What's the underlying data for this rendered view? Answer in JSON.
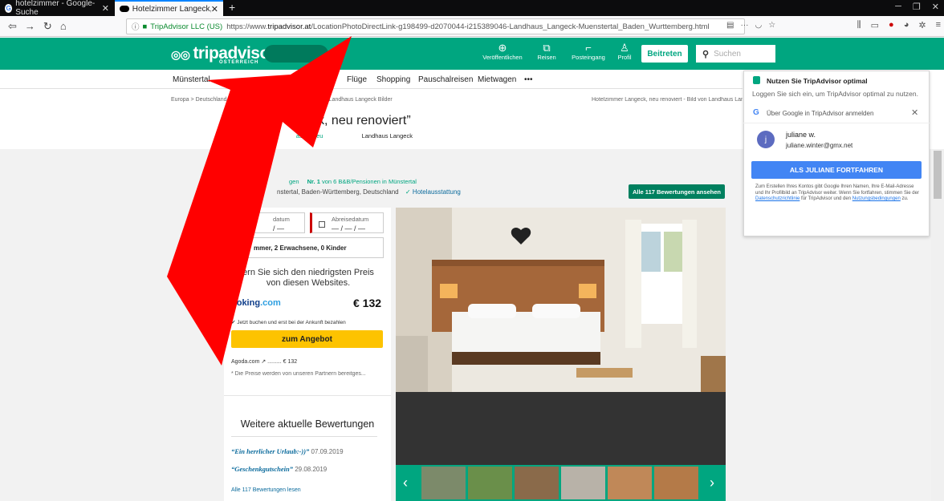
{
  "browser": {
    "tabs": [
      {
        "title": "hotelzimmer - Google-Suche"
      },
      {
        "title": "Hotelzimmer Langeck, neu ren"
      }
    ],
    "url_site": "TripAdvisor LLC (US)",
    "url_prefix": "https://www.",
    "url_host": "tripadvisor.at",
    "url_path": "/LocationPhotoDirectLink-g198499-d2070044-i215389046-Landhaus_Langeck-Muenstertal_Baden_Wurttemberg.html",
    "url_overflow": "···"
  },
  "header": {
    "logo": "tripadvisor",
    "logo_region": "ÖSTERREICH",
    "nav": [
      {
        "label": "Veröffentlichen",
        "icon": "plus-circle-icon",
        "glyph": "⊕"
      },
      {
        "label": "Reisen",
        "icon": "suitcase-icon",
        "glyph": "⧉"
      },
      {
        "label": "Posteingang",
        "icon": "chat-icon",
        "glyph": "⌐"
      },
      {
        "label": "Profil",
        "icon": "user-icon",
        "glyph": "♙"
      }
    ],
    "join_label": "Beitreten",
    "search_placeholder": "Suchen"
  },
  "subnav": {
    "items": [
      "Münstertal",
      "ts",
      "Flüge",
      "Shopping",
      "Pauschalreisen",
      "Mietwagen",
      "•••"
    ]
  },
  "breadcrumbs": {
    "left": [
      "Europa",
      "Deutschland",
      "Bad"
    ],
    "mid": "rtal B&B",
    "last": "Landhaus Langeck Bilder",
    "right": "Hotelzimmer Langeck, neu renoviert - Bild von Landhaus Langec"
  },
  "page": {
    "title": "Fo                 geck, neu renoviert”",
    "subtitle_a": "A",
    "subtitle_b": "assik, neu",
    "subtitle_c": "Landhaus Langeck"
  },
  "listing": {
    "reviews_suffix": "gen",
    "rank_bold": "Nr. 1",
    "rank_text": "von 6 B&B/Pensionen in Münstertal",
    "address": "nstertal, Baden-Württemberg, Deutschland",
    "amenities": "Hotelausstattung",
    "all_reviews_button": "Alle 117 Bewertungen ansehen"
  },
  "booking": {
    "checkin_label": "datum",
    "checkin_value": "/ —",
    "checkout_label": "Abreisedatum",
    "checkout_value": "— / — / —",
    "guests": "mmer, 2 Erwachsene, 0 Kinder",
    "price_hint_1": "ern Sie sich den niedrigsten Preis",
    "price_hint_2": "von diesen Websites.",
    "provider_a": "ooking",
    "provider_b": ".com",
    "price": "€ 132",
    "note": "Jetzt buchen und erst bei der Ankunft bezahlen",
    "deal_button": "zum Angebot",
    "alt_provider": "Agoda.com ↗ ......... € 132",
    "partner_note": "* Die Preise werden von unseren Partnern bereitges..."
  },
  "reviews": {
    "heading": "Weitere aktuelle Bewertungen",
    "items": [
      {
        "title": "“Ein herrlicher Urlaub:-))”",
        "date": "07.09.2019"
      },
      {
        "title": "“Geschenkgutschein”",
        "date": "29.08.2019"
      }
    ],
    "read_all": "Alle 117 Bewertungen lesen"
  },
  "google_popup": {
    "title": "Nutzen Sie TripAdvisor optimal",
    "subtitle": "Loggen Sie sich ein, um TripAdvisor optimal zu nutzen.",
    "google_label": "Über Google in TripAdvisor anmelden",
    "avatar_letter": "j",
    "user_name": "juliane w.",
    "user_email": "juliane.winter@gmx.net",
    "continue_button": "ALS JULIANE FORTFAHREN",
    "legal_1": "Zum Erstellen Ihres Kontos gibt Google Ihren Namen, Ihre E-Mail-Adresse und Ihr Profilbild an TripAdvisor weiter. Wenn Sie fortfahren, stimmen Sie der ",
    "legal_link1": "Datenschutzrichtlinie",
    "legal_2": " für TripAdvisor und den ",
    "legal_link2": "Nutzungsbedingungen",
    "legal_3": " zu."
  },
  "colors": {
    "brand": "#00a680",
    "arrow": "#ff0000",
    "deal_button": "#fdc300",
    "google_button": "#4285f4"
  }
}
